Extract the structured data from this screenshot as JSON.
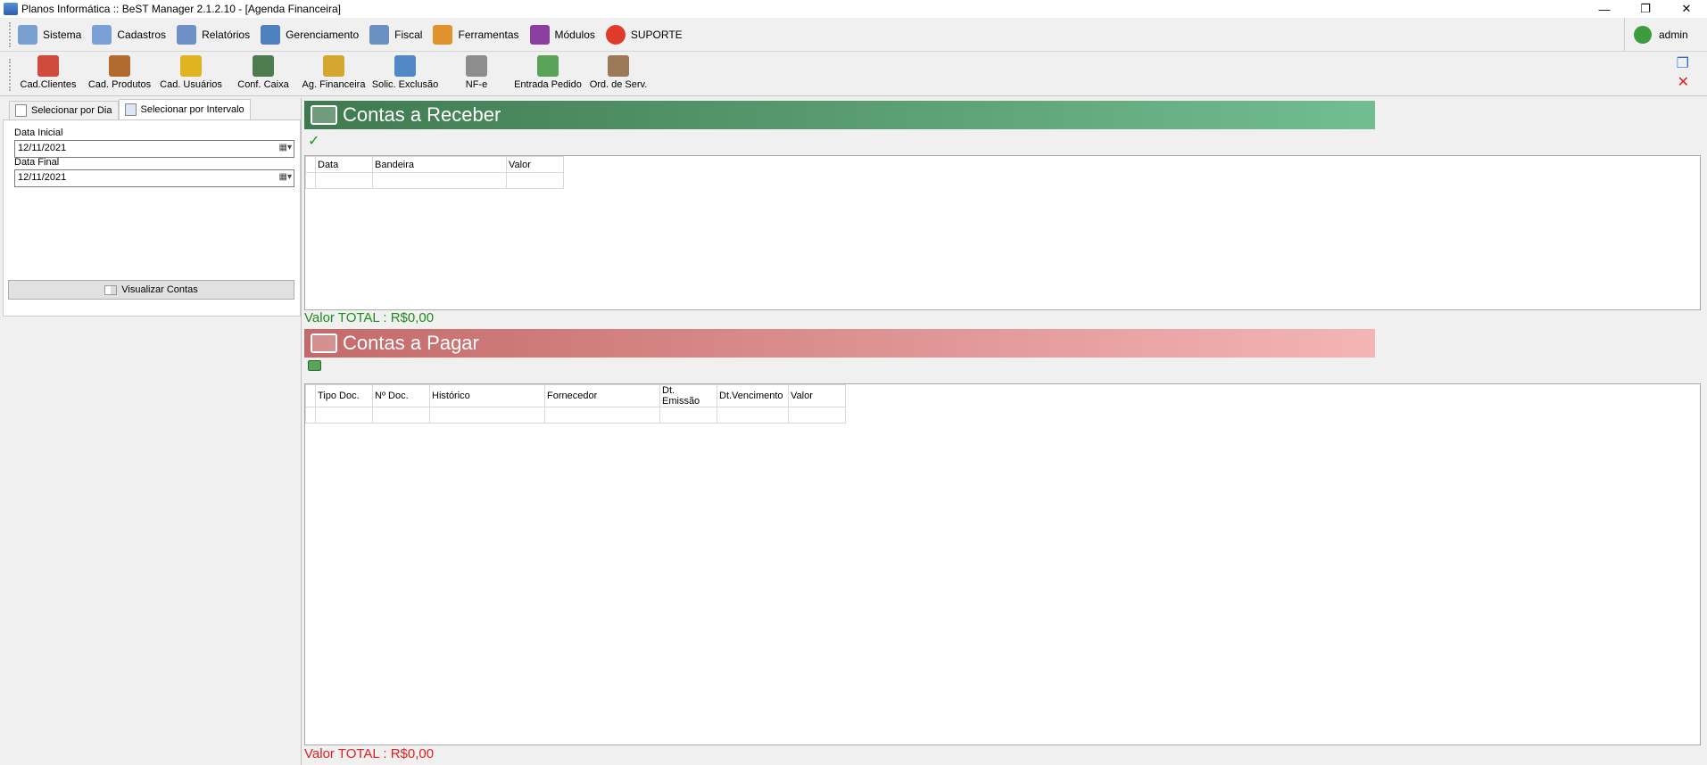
{
  "window": {
    "title": "Planos Informática :: BeST Manager 2.1.2.10 - [Agenda Financeira]",
    "controls": [
      "—",
      "❐",
      "✕"
    ]
  },
  "menu": {
    "items": [
      {
        "label": "Sistema",
        "icon": "window-list-icon",
        "color": "#7a9fd1"
      },
      {
        "label": "Cadastros",
        "icon": "database-icon",
        "color": "#7aa0d8"
      },
      {
        "label": "Relatórios",
        "icon": "report-icon",
        "color": "#6f8fc7"
      },
      {
        "label": "Gerenciamento",
        "icon": "briefcase-icon",
        "color": "#4e7fbf"
      },
      {
        "label": "Fiscal",
        "icon": "calculator-icon",
        "color": "#6c8fc2"
      },
      {
        "label": "Ferramentas",
        "icon": "wrench-icon",
        "color": "#e0922e"
      },
      {
        "label": "Módulos",
        "icon": "modules-icon",
        "color": "#8a3fa0"
      },
      {
        "label": "SUPORTE",
        "icon": "lifebuoy-icon",
        "color": "#e03a2a"
      }
    ],
    "user": "admin"
  },
  "toolbar": {
    "buttons": [
      {
        "label": "Cad.Clientes",
        "icon": "clients-icon",
        "color": "#d04a3e"
      },
      {
        "label": "Cad. Produtos",
        "icon": "products-icon",
        "color": "#b36a2f"
      },
      {
        "label": "Cad. Usuários",
        "icon": "key-icon",
        "color": "#e0b420"
      },
      {
        "label": "Conf. Caixa",
        "icon": "cash-register-icon",
        "color": "#4e7c4e"
      },
      {
        "label": "Ag. Financeira",
        "icon": "coins-icon",
        "color": "#d4a830"
      },
      {
        "label": "Solic. Exclusão",
        "icon": "network-icon",
        "color": "#4f87c7"
      },
      {
        "label": "NF-e",
        "icon": "invoice-icon",
        "color": "#8d8d8d"
      },
      {
        "label": "Entrada Pedido",
        "icon": "order-entry-icon",
        "color": "#5aa35a"
      },
      {
        "label": "Ord. de Serv.",
        "icon": "clipboard-icon",
        "color": "#9a7a58"
      }
    ]
  },
  "left": {
    "tabs": [
      "Selecionar por Dia",
      "Selecionar por Intervalo"
    ],
    "data_inicial_label": "Data Inicial",
    "data_inicial_value": "12/11/2021",
    "data_final_label": "Data Final",
    "data_final_value": "12/11/2021",
    "view_button": "Visualizar Contas"
  },
  "receber": {
    "title": "Contas a Receber",
    "columns": [
      "Data",
      "Bandeira",
      "Valor"
    ],
    "total": "Valor TOTAL : R$0,00"
  },
  "pagar": {
    "title": "Contas a Pagar",
    "columns": [
      "Tipo Doc.",
      "Nº Doc.",
      "Histórico",
      "Fornecedor",
      "Dt. Emissão",
      "Dt.Vencimento",
      "Valor"
    ],
    "total": "Valor TOTAL : R$0,00"
  }
}
